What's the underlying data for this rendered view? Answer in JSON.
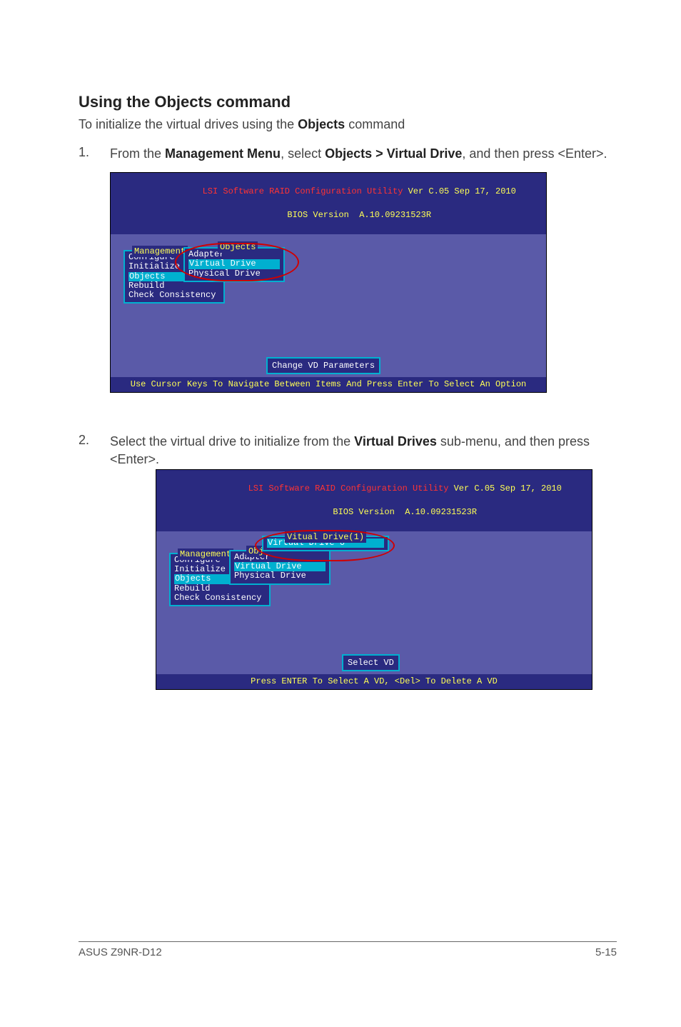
{
  "heading": "Using the Objects command",
  "intro_pre": "To initialize the virtual drives using the ",
  "intro_bold": "Objects",
  "intro_post": " command",
  "steps": [
    {
      "num": "1.",
      "pre": "From the ",
      "bold1": "Management Menu",
      "mid1": ", select ",
      "bold2": "Objects > Virtual Drive",
      "mid2": ", and then press <Enter>."
    },
    {
      "num": "2.",
      "pre": "Select the virtual drive to initialize from the ",
      "bold1": "Virtual Drives",
      "mid1": " sub-menu, and then press <Enter>.",
      "bold2": "",
      "mid2": ""
    }
  ],
  "bios1": {
    "title_l1a": "LSI Software RAID Configuration Utility ",
    "title_l1b": "Ver C.05 Sep 17, 2010",
    "title_l2a": "BIOS Version  ",
    "title_l2b": "A.10.09231523R",
    "mgmt_label": "Management",
    "mgmt_items": [
      "Configure",
      "Initialize",
      "Objects",
      "Rebuild",
      "Check Consistency"
    ],
    "obj_label": "Objects",
    "obj_items": [
      "Adapter",
      "Virtual Drive",
      "Physical Drive"
    ],
    "hint": "Change VD Parameters",
    "status": "Use Cursor Keys To Navigate Between Items And Press Enter To Select An Option"
  },
  "bios2": {
    "title_l1a": "LSI Software RAID Configuration Utility ",
    "title_l1b": "Ver C.05 Sep 17, 2010",
    "title_l2a": "BIOS Version  ",
    "title_l2b": "A.10.09231523R",
    "mgmt_label": "Management",
    "mgmt_items": [
      "Configure",
      "Initialize",
      "Objects",
      "Rebuild",
      "Check Consistency"
    ],
    "obj_label": "Obj",
    "obj_items": [
      "Adapter",
      "Virtual Drive",
      "Physical Drive"
    ],
    "vd_label": "Vitual Drive(1)",
    "vd_items": [
      "Virtual Drive 0"
    ],
    "hint": "Select VD",
    "status": "Press ENTER To Select A VD, <Del> To Delete A VD"
  },
  "footer_left": "ASUS Z9NR-D12",
  "footer_right": "5-15"
}
